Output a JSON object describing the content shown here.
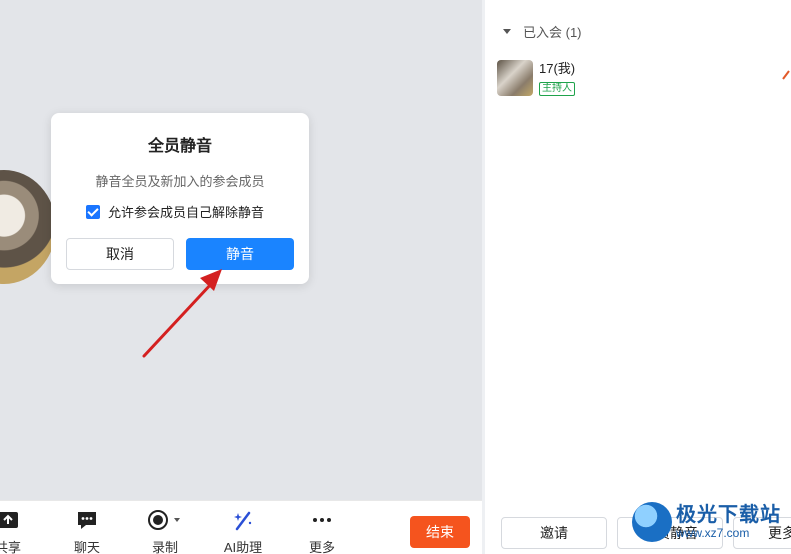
{
  "dialog": {
    "title": "全员静音",
    "description": "静音全员及新加入的参会成员",
    "checkbox_label": "允许参会成员自己解除静音",
    "checkbox_checked": true,
    "cancel_label": "取消",
    "confirm_label": "静音"
  },
  "toolbar": {
    "share_label": "共享",
    "chat_label": "聊天",
    "record_label": "录制",
    "ai_label": "AI助理",
    "more_label": "更多",
    "end_label": "结束"
  },
  "panel": {
    "section_title": "已入会 (1)",
    "member": {
      "name": "17(我)",
      "role_badge": "主持人"
    },
    "invite_label": "邀请",
    "mute_all_label": "全员静音",
    "more_label": "更多"
  },
  "watermark": {
    "title": "极光下载站",
    "url": "www.xz7.com"
  },
  "colors": {
    "primary_blue": "#1a84ff",
    "end_orange": "#f5541e",
    "host_green": "#1fa34b",
    "arrow_red": "#d42020"
  }
}
